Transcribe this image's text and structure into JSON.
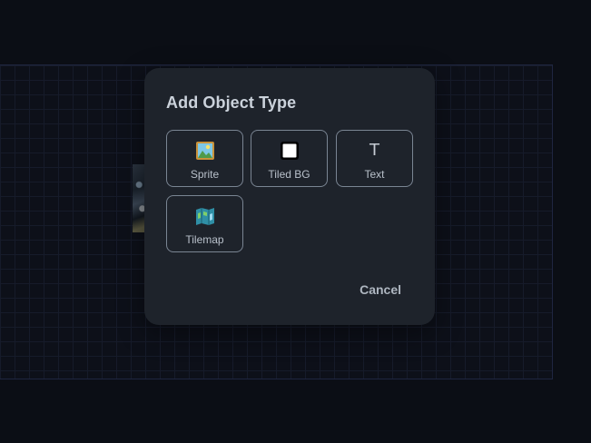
{
  "dialog": {
    "title": "Add Object Type",
    "options": [
      {
        "label": "Sprite",
        "icon": "picture-icon"
      },
      {
        "label": "Tiled BG",
        "icon": "white-square-icon"
      },
      {
        "label": "Text",
        "icon": "text-t-icon",
        "glyph": "T"
      },
      {
        "label": "Tilemap",
        "icon": "map-icon"
      }
    ],
    "cancel_label": "Cancel"
  },
  "colors": {
    "background": "#0b0e15",
    "dialog": "#1e232b",
    "tile_border": "#7a8593",
    "text": "#cbd2db"
  }
}
